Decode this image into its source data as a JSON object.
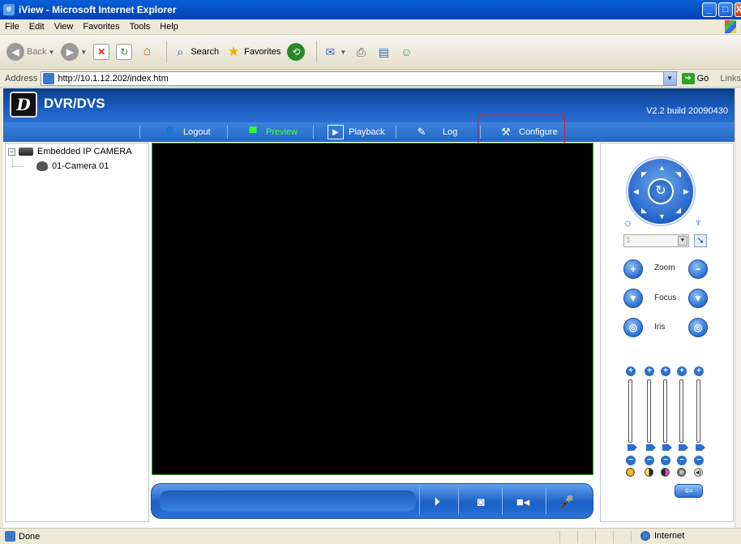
{
  "window": {
    "title": "iView - Microsoft Internet Explorer",
    "minimize": "_",
    "maximize": "□",
    "close": "X"
  },
  "menu": [
    "File",
    "Edit",
    "View",
    "Favorites",
    "Tools",
    "Help"
  ],
  "toolbar": {
    "back": "Back",
    "search": "Search",
    "favorites": "Favorites"
  },
  "address": {
    "label": "Address",
    "url": "http://10.1.12.202/index.htm",
    "go": "Go",
    "links": "Links"
  },
  "app": {
    "brand": "DVR/DVS",
    "version": "V2.2 build 20090430",
    "nav": {
      "logout": "Logout",
      "preview": "Preview",
      "playback": "Playback",
      "log": "Log",
      "configure": "Configure"
    },
    "active_nav": "Preview",
    "accent_color": "#2167c6",
    "highlight_color": "#e0182a"
  },
  "tree": {
    "root": "Embedded IP CAMERA",
    "child": "01-Camera 01"
  },
  "ptz": {
    "preset_value": "1",
    "zoom": "Zoom",
    "focus": "Focus",
    "iris": "Iris"
  },
  "status": {
    "text": "Done",
    "zone": "Internet"
  }
}
